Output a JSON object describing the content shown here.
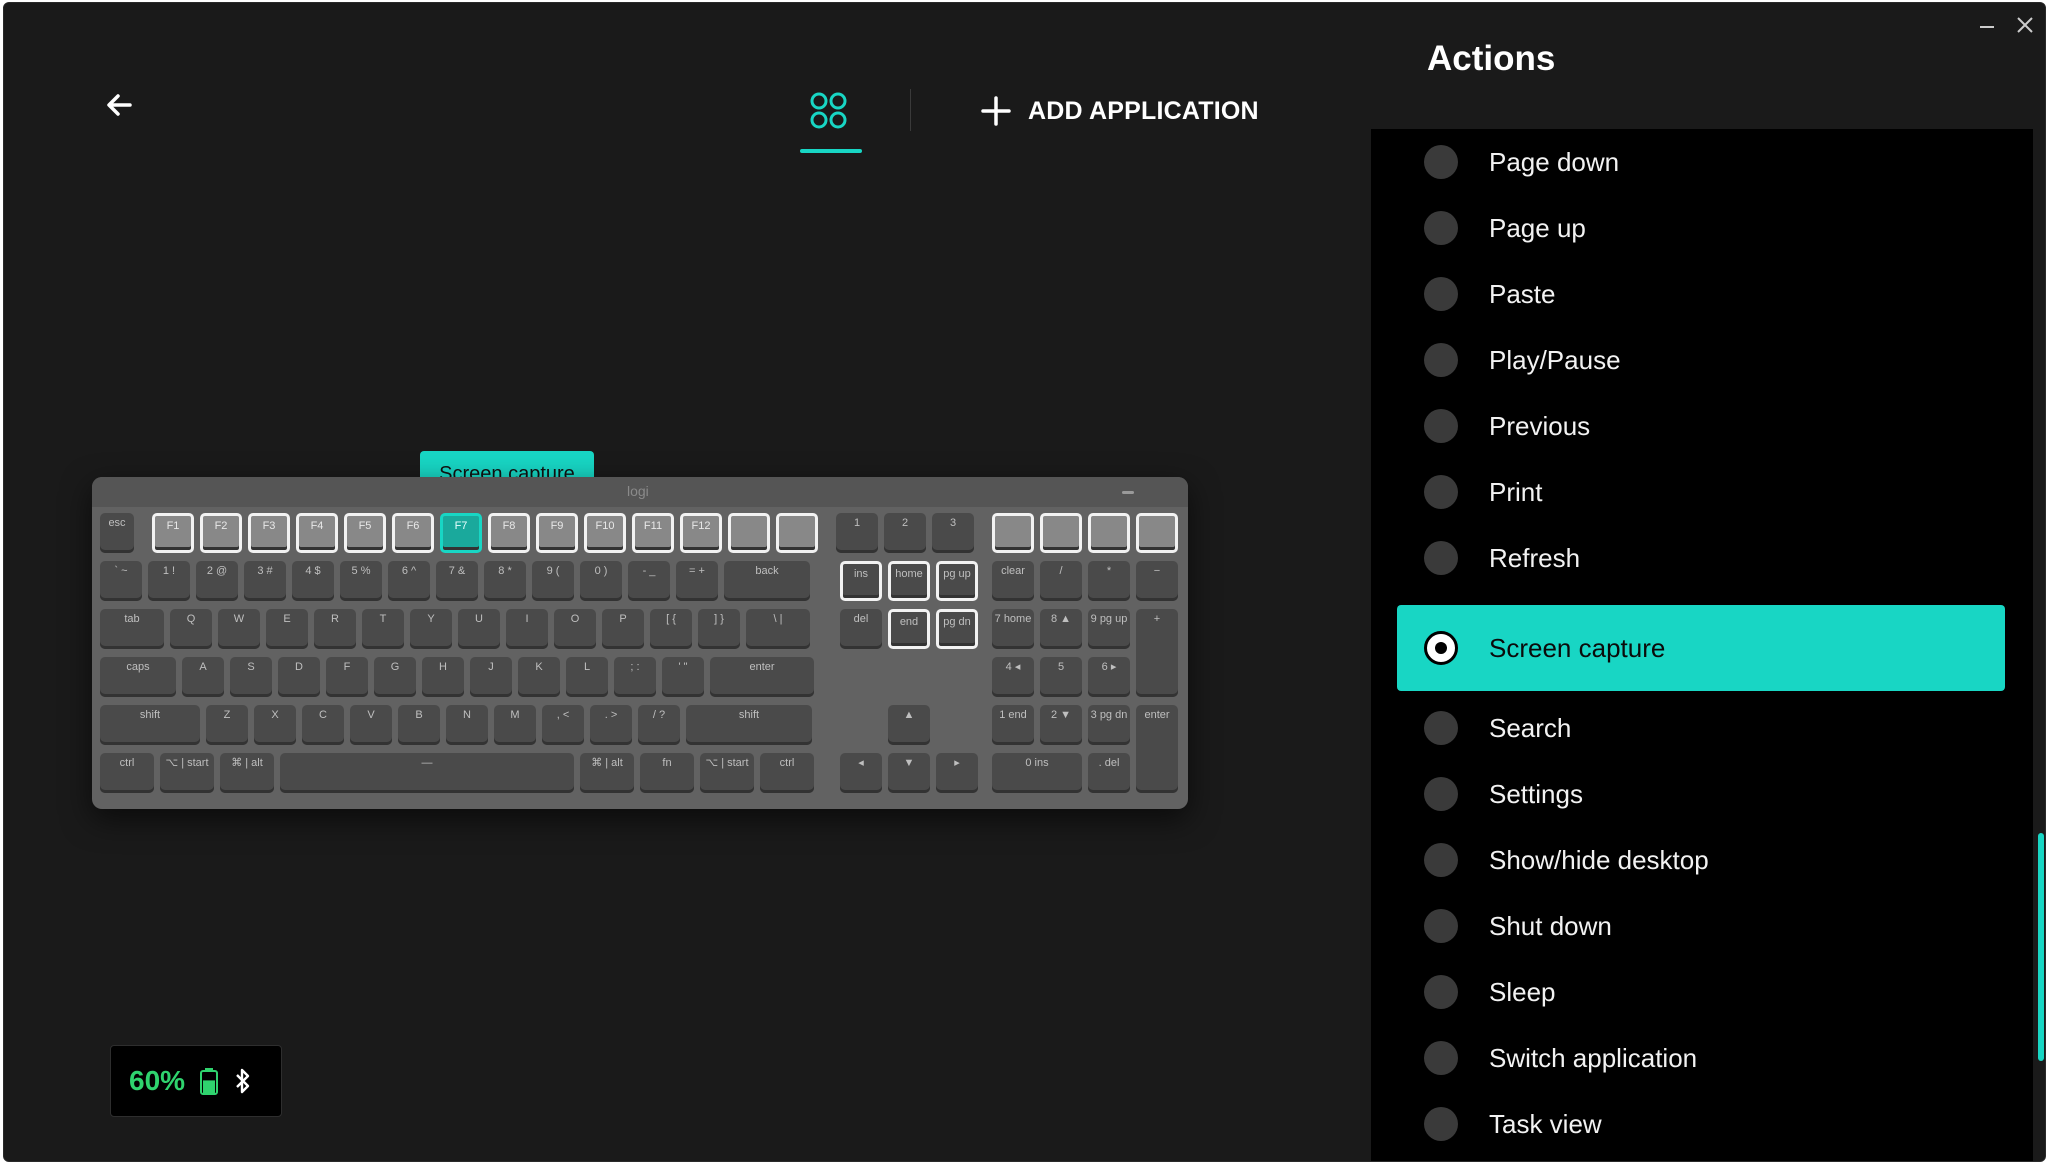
{
  "header": {
    "back_icon": "arrow-left-icon",
    "apps_icon": "four-circles-grid-icon",
    "add_application_icon": "plus-icon",
    "add_application_label": "ADD APPLICATION"
  },
  "tooltip": {
    "text": "Screen capture"
  },
  "keyboard": {
    "brand": "logi",
    "row0": [
      "esc",
      "F1",
      "F2",
      "F3",
      "F4",
      "F5",
      "F6",
      "F7",
      "F8",
      "F9",
      "F10",
      "F11",
      "F12",
      "",
      "",
      "1",
      "2",
      "3",
      "",
      "",
      "",
      ""
    ],
    "row1": [
      "` ~",
      "1 !",
      "2 @",
      "3 #",
      "4 $",
      "5 %",
      "6 ^",
      "7 &",
      "8 *",
      "9 (",
      "0 )",
      "- _",
      "= +",
      "back",
      "ins",
      "home",
      "pg up",
      "clear",
      "/",
      "*",
      "−"
    ],
    "row2": [
      "tab",
      "Q",
      "W",
      "E",
      "R",
      "T",
      "Y",
      "U",
      "I",
      "O",
      "P",
      "[ {",
      "] }",
      "\\ |",
      "del",
      "end",
      "pg dn",
      "7 home",
      "8 ▲",
      "9 pg up",
      "+"
    ],
    "row3": [
      "caps",
      "A",
      "S",
      "D",
      "F",
      "G",
      "H",
      "J",
      "K",
      "L",
      "; :",
      "' \"",
      "enter",
      "4 ◂",
      "5",
      "6 ▸"
    ],
    "row4": [
      "shift",
      "Z",
      "X",
      "C",
      "V",
      "B",
      "N",
      "M",
      ", <",
      ". >",
      "/ ?",
      "shift",
      "▲",
      "1 end",
      "2 ▼",
      "3 pg dn",
      "enter"
    ],
    "row5": [
      "ctrl",
      "⌥ | start",
      "⌘ | alt",
      "—",
      "⌘ | alt",
      "fn",
      "⌥ | start",
      "ctrl",
      "◂",
      "▼",
      "▸",
      "0 ins",
      ". del"
    ],
    "selected_key": "F7"
  },
  "battery": {
    "percent": "60%",
    "battery_icon": "battery-icon",
    "connection_icon": "bluetooth-icon",
    "level": 0.6
  },
  "actions": {
    "title": "Actions",
    "items": [
      "Page down",
      "Page up",
      "Paste",
      "Play/Pause",
      "Previous",
      "Print",
      "Refresh",
      "Screen capture",
      "Search",
      "Settings",
      "Show/hide desktop",
      "Shut down",
      "Sleep",
      "Switch application",
      "Task view"
    ],
    "selected": "Screen capture"
  },
  "colors": {
    "accent": "#18d6c4",
    "background": "#1a1a1a",
    "list_bg": "#000000",
    "battery_green": "#2fd36e"
  }
}
